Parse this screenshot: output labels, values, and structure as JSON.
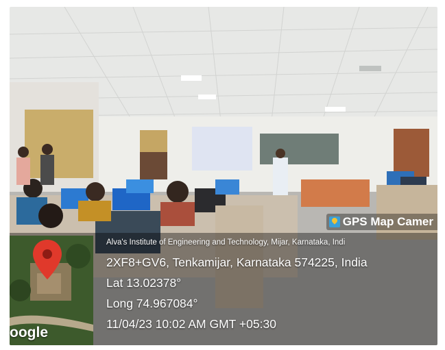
{
  "stamp": {
    "app_badge": "GPS Map Camer",
    "address_full": "Alva's Institute of Engineering and Technology, Mijar, Karnataka, Indi",
    "address_short": "2XF8+GV6, Tenkamijar, Karnataka 574225, India",
    "lat": "Lat 13.02378°",
    "long": "Long 74.967084°",
    "datetime": "11/04/23 10:02 AM GMT +05:30",
    "map_provider": "oogle"
  },
  "colors": {
    "pin": "#e0392b",
    "badge_icon": "#3aa0d8"
  }
}
